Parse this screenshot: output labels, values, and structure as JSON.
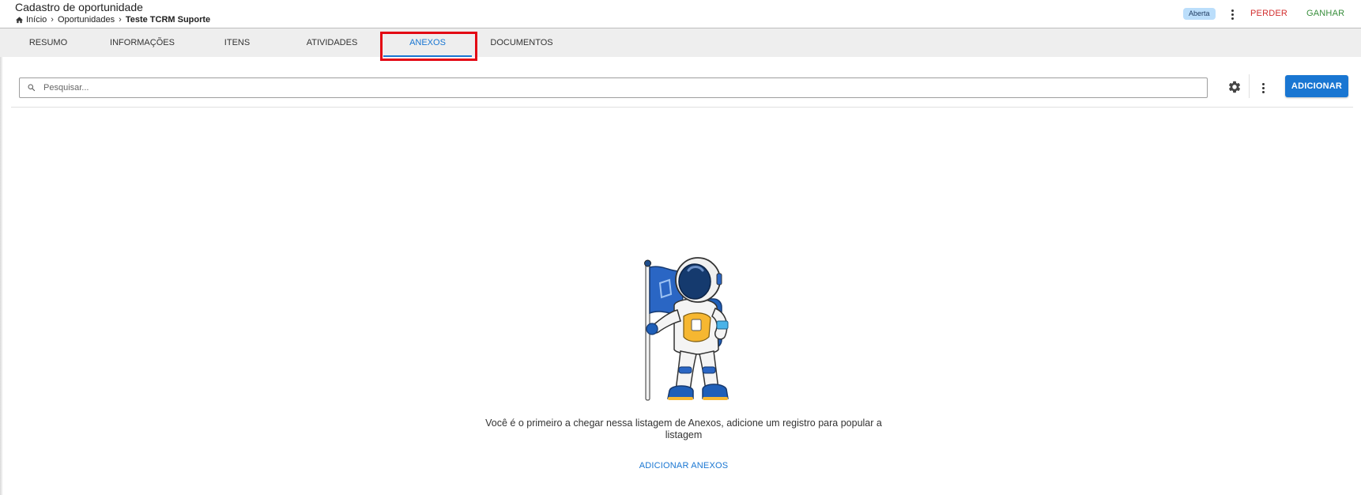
{
  "header": {
    "title": "Cadastro de oportunidade",
    "breadcrumb": [
      "Início",
      "Oportunidades",
      "Teste TCRM Suporte"
    ],
    "status_badge": "Aberta",
    "lose_label": "PERDER",
    "win_label": "GANHAR"
  },
  "tabs": [
    {
      "label": "RESUMO",
      "active": false
    },
    {
      "label": "INFORMAÇÕES",
      "active": false
    },
    {
      "label": "ITENS",
      "active": false
    },
    {
      "label": "ATIVIDADES",
      "active": false
    },
    {
      "label": "ANEXOS",
      "active": true
    },
    {
      "label": "DOCUMENTOS",
      "active": false
    }
  ],
  "toolbar": {
    "search_placeholder": "Pesquisar...",
    "search_value": "",
    "add_label": "ADICIONAR"
  },
  "empty_state": {
    "message": "Você é o primeiro a chegar nessa listagem de Anexos, adicione um registro para popular a listagem",
    "add_link": "ADICIONAR ANEXOS"
  },
  "icons": [
    "home-icon",
    "chevron-right-icon",
    "search-icon",
    "gear-icon",
    "more-vert-icon",
    "astronaut-illustration"
  ],
  "colors": {
    "primary": "#1976d2",
    "lose": "#d32f2f",
    "win": "#388e3c",
    "badge_bg": "#bbdefb",
    "tabs_bg": "#eeeeee",
    "highlight": "#e30613"
  }
}
